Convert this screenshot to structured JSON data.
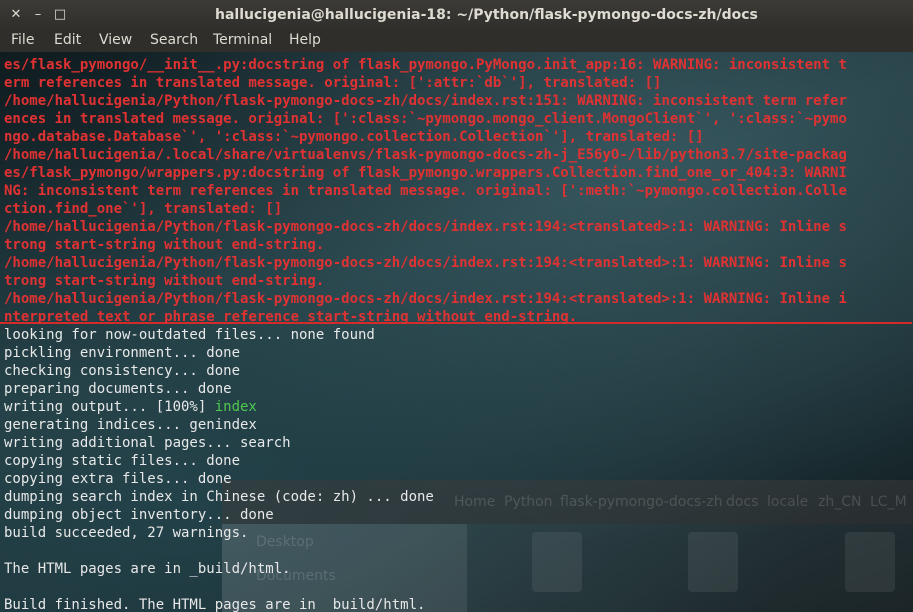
{
  "window": {
    "title": "hallucigenia@hallucigenia-18: ~/Python/flask-pymongo-docs-zh/docs",
    "close_glyph": "✕",
    "minimize_glyph": "–",
    "maximize_glyph": "□"
  },
  "menu": [
    "File",
    "Edit",
    "View",
    "Search",
    "Terminal",
    "Help"
  ],
  "colors": {
    "warning": "#e03232",
    "highlight": "#4ec94e",
    "normal": "#e8e8e8",
    "frame": "#d42a2a"
  },
  "terminal": {
    "warning_lines": [
      "es/flask_pymongo/__init__.py:docstring of flask_pymongo.PyMongo.init_app:16: WARNING: inconsistent t",
      "erm references in translated message. original: [':attr:`db`'], translated: []",
      "/home/hallucigenia/Python/flask-pymongo-docs-zh/docs/index.rst:151: WARNING: inconsistent term refer",
      "ences in translated message. original: [':class:`~pymongo.mongo_client.MongoClient`', ':class:`~pymo",
      "ngo.database.Database`', ':class:`~pymongo.collection.Collection`'], translated: []",
      "/home/hallucigenia/.local/share/virtualenvs/flask-pymongo-docs-zh-j_E56yO-/lib/python3.7/site-packag",
      "es/flask_pymongo/wrappers.py:docstring of flask_pymongo.wrappers.Collection.find_one_or_404:3: WARNI",
      "NG: inconsistent term references in translated message. original: [':meth:`~pymongo.collection.Colle",
      "ction.find_one`'], translated: []",
      "/home/hallucigenia/Python/flask-pymongo-docs-zh/docs/index.rst:194:<translated>:1: WARNING: Inline s",
      "trong start-string without end-string.",
      "/home/hallucigenia/Python/flask-pymongo-docs-zh/docs/index.rst:194:<translated>:1: WARNING: Inline s",
      "trong start-string without end-string.",
      "/home/hallucigenia/Python/flask-pymongo-docs-zh/docs/index.rst:194:<translated>:1: WARNING: Inline i",
      "nterpreted text or phrase reference start-string without end-string."
    ],
    "normal_lines": [
      "looking for now-outdated files... none found",
      "pickling environment... done",
      "checking consistency... done",
      "preparing documents... done"
    ],
    "writing_output_prefix": "writing output... [100%] ",
    "writing_output_highlight": "index",
    "tail_lines": [
      "generating indices... genindex",
      "writing additional pages... search",
      "copying static files... done",
      "copying extra files... done",
      "dumping search index in Chinese (code: zh) ... done",
      "dumping object inventory... done",
      "build succeeded, 27 warnings.",
      "",
      "The HTML pages are in _build/html.",
      "",
      "Build finished. The HTML pages are in _build/html."
    ]
  },
  "background_window": {
    "breadcrumb": [
      "Home",
      "Python",
      "flask-pymongo-docs-zh",
      "docs",
      "locale",
      "zh_CN",
      "LC_M"
    ],
    "sidebar": [
      "Desktop",
      "Documents"
    ]
  }
}
